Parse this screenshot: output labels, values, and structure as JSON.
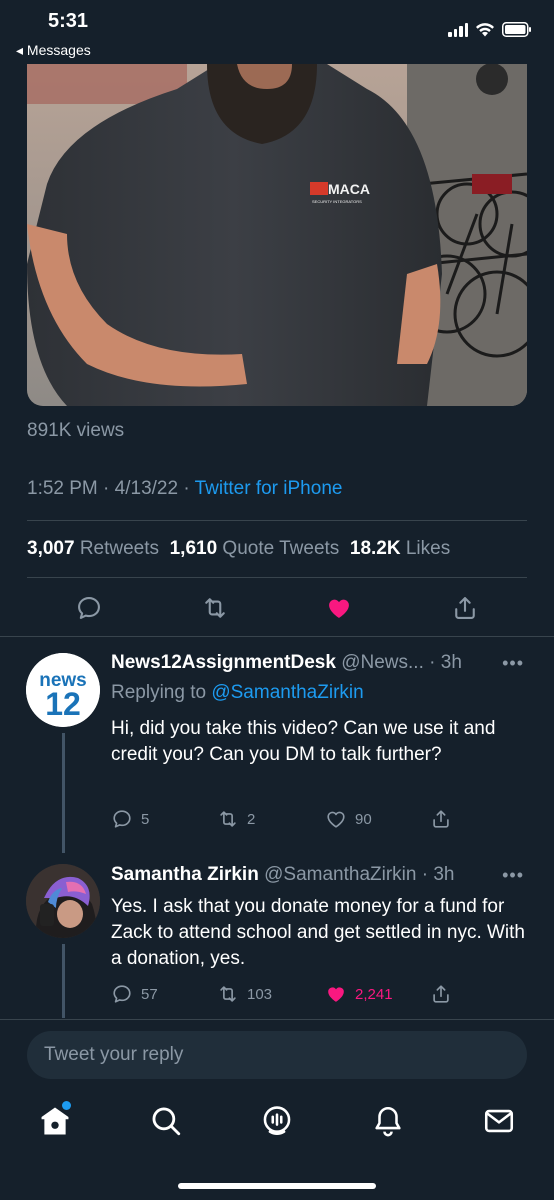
{
  "status": {
    "time": "5:31",
    "back": "◂ Messages"
  },
  "video": {
    "shirt_logo": "MACA",
    "shirt_logo_sub": "SECURITY INTEGRATORS"
  },
  "tweet": {
    "views": "891K views",
    "time": "1:52 PM",
    "date": "4/13/22",
    "sep": "·",
    "source": "Twitter for iPhone",
    "retweets": "3,007",
    "retweets_label": "Retweets",
    "quotes": "1,610",
    "quotes_label": "Quote Tweets",
    "likes": "18.2K",
    "likes_label": "Likes",
    "liked": true
  },
  "replies": [
    {
      "avatar_text": "news",
      "avatar_num": "12",
      "name": "News12AssignmentDesk",
      "handle": "@News...",
      "time": "· 3h",
      "replying_prefix": "Replying to ",
      "replying_to": "@SamanthaZirkin",
      "text": "Hi, did you take this video? Can we use it and credit you? Can you DM to talk further?",
      "replies": "5",
      "retweets": "2",
      "likes": "90",
      "liked": false
    },
    {
      "name": "Samantha Zirkin",
      "handle": "@SamanthaZirkin",
      "time": "· 3h",
      "text": "Yes. I ask that you donate money for a fund for Zack to attend school and get settled in nyc. With a donation, yes.",
      "replies": "57",
      "retweets": "103",
      "likes": "2,241",
      "liked": true
    }
  ],
  "compose": {
    "placeholder": "Tweet your reply"
  },
  "more_label": "•••",
  "colors": {
    "background": "#15202b",
    "accent": "#1d9bf0",
    "like": "#f91880",
    "muted": "#8b98a5"
  }
}
